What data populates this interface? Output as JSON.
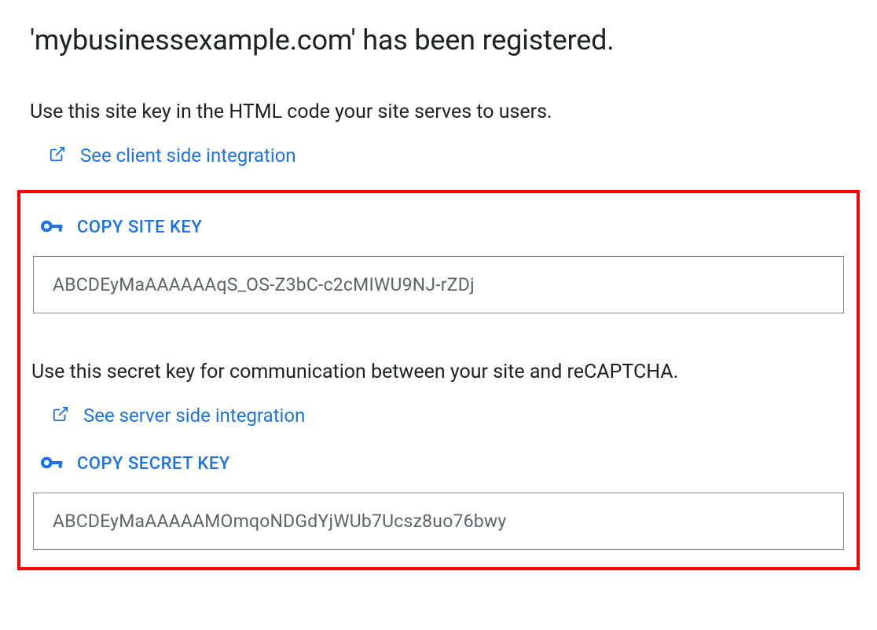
{
  "title": "'mybusinessexample.com' has been registered.",
  "site_key": {
    "instruction": "Use this site key in the HTML code your site serves to users.",
    "link_label": "See client side integration",
    "copy_label": "COPY SITE KEY",
    "value": "ABCDEyMaAAAAAAqS_OS-Z3bC-c2cMIWU9NJ-rZDj"
  },
  "secret_key": {
    "instruction": "Use this secret key for communication between your site and reCAPTCHA.",
    "link_label": "See server side integration",
    "copy_label": "COPY SECRET KEY",
    "value": "ABCDEyMaAAAAAMOmqoNDGdYjWUb7Ucsz8uo76bwy"
  }
}
